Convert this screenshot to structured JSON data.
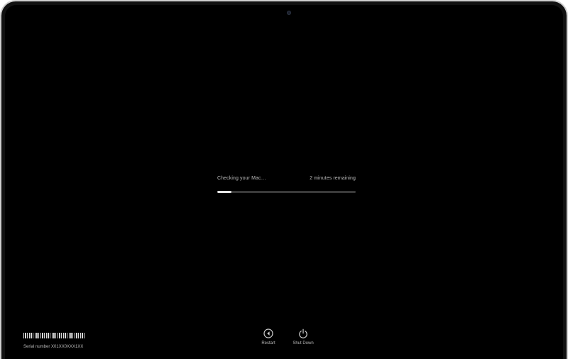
{
  "progress": {
    "status_text": "Checking your Mac…",
    "time_remaining": "2 minutes remaining",
    "fraction": 0.1
  },
  "serial": {
    "label": "Serial number X01XX0XXX1XX"
  },
  "actions": {
    "restart_label": "Restart",
    "shutdown_label": "Shut Down"
  },
  "icons": {
    "restart": "restart-icon",
    "shutdown": "power-icon",
    "barcode": "barcode-icon"
  },
  "colors": {
    "screen": "#000000",
    "text": "#b9b9b9",
    "track": "#3a3a3a",
    "fill": "#e6e6e6"
  }
}
